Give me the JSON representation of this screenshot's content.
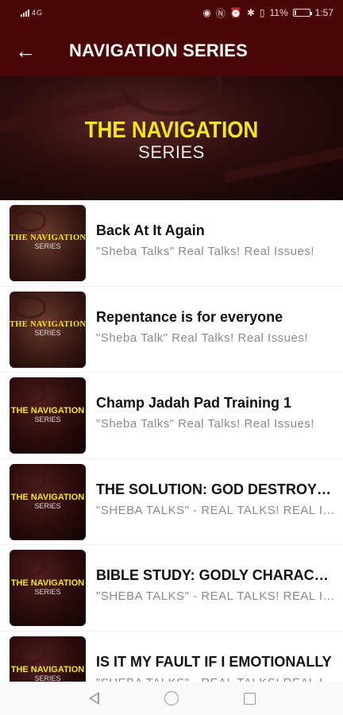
{
  "status_bar": {
    "network_label": "4G",
    "battery_text": "11%",
    "battery_level": 0.11,
    "time": "1:57",
    "icons": [
      "wifi-icon",
      "nfc-icon",
      "alarm-icon",
      "bluetooth-icon",
      "vibrate-icon",
      "battery-icon",
      "signal-icon"
    ]
  },
  "app_bar": {
    "back_icon": "arrow-left-icon",
    "title": "NAVIGATION SERIES",
    "background": "#4a0707"
  },
  "banner": {
    "title": "THE NAVIGATION",
    "subtitle": "SERIES",
    "title_color": "#f5e51f"
  },
  "episodes": [
    {
      "title": "Back At It Again",
      "description": "\"Sheba Talks\" Real Talks! Real Issues!",
      "thumb_title": "THE NAVIGATION",
      "thumb_sub": "SERIES",
      "thumb_style": "light"
    },
    {
      "title": "Repentance is for everyone",
      "description": "\"Sheba Talk\" Real Talks! Real Issues!",
      "thumb_title": "THE NAVIGATION",
      "thumb_sub": "SERIES",
      "thumb_style": "light"
    },
    {
      "title": "Champ Jadah Pad Training 1",
      "description": "\"Sheba Talks\" Real Talks! Real Issues!",
      "thumb_title": "THE NAVIGATION",
      "thumb_sub": "SERIES",
      "thumb_style": "dark"
    },
    {
      "title": "THE SOLUTION: GOD DESTROYS THE WORKS",
      "description": "\"SHEBA TALKS\" - REAL TALKS! REAL ISSUES!",
      "thumb_title": "THE NAVIGATION",
      "thumb_sub": "SERIES",
      "thumb_style": "dark"
    },
    {
      "title": "BIBLE STUDY: GODLY CHARACTER",
      "description": "\"SHEBA TALKS\" - REAL TALKS! REAL ISSUES!",
      "thumb_title": "THE NAVIGATION",
      "thumb_sub": "SERIES",
      "thumb_style": "dark"
    },
    {
      "title": "IS IT MY FAULT IF I EMOTIONALLY",
      "description": "\"SHEBA TALKS\" - REAL TALKS! REAL ISSUES!",
      "thumb_title": "THE NAVIGATION",
      "thumb_sub": "SERIES",
      "thumb_style": "dark"
    }
  ],
  "nav_bar": {
    "buttons": [
      "back-triangle-icon",
      "home-circle-icon",
      "recents-square-icon"
    ]
  }
}
